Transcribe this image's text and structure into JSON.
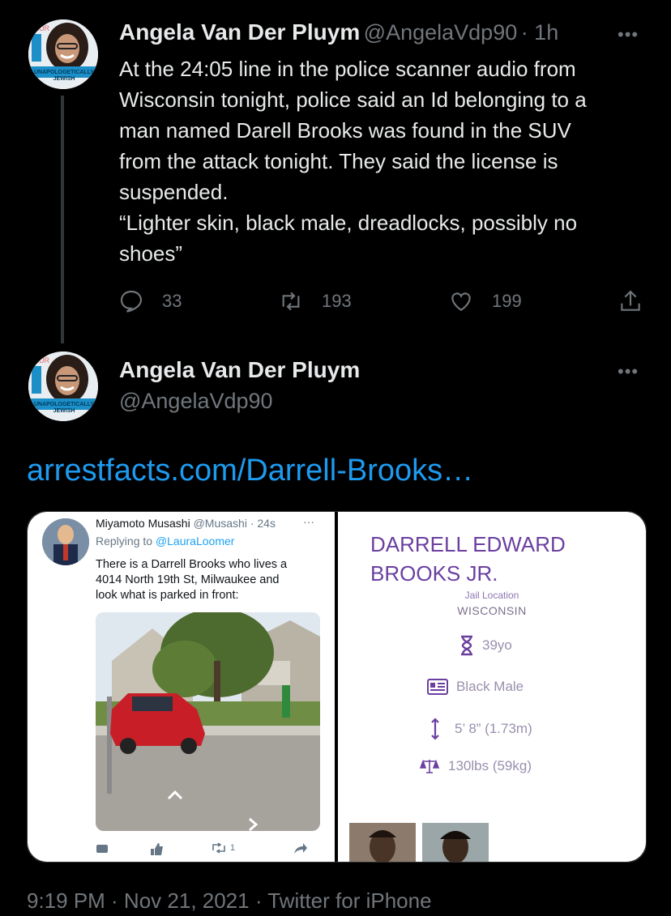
{
  "tweet1": {
    "name": "Angela Van Der Pluym",
    "handle": "@AngelaVdp90",
    "time": "· 1h",
    "text": "At the 24:05 line in the police scanner audio from\nWisconsin tonight, police said an Id belonging to a\nman named Darell Brooks was found in the SUV\nfrom the attack tonight. They said the license is\nsuspended.\n“Lighter skin, black male, dreadlocks, possibly no\nshoes”",
    "replies": "33",
    "retweets": "193",
    "likes": "199",
    "more": "•••"
  },
  "avatar": {
    "top_text": "LAUR",
    "banner_text": "UNAPOLOGETICALLY",
    "banner_sub": "JEWISH"
  },
  "tweet2": {
    "name": "Angela Van Der Pluym",
    "handle": "@AngelaVdp90",
    "more": "•••",
    "link": "arrestfacts.com/Darrell-Brooks…"
  },
  "embedded": {
    "name": "Miyamoto Musashi",
    "handle": "@Musashi",
    "time": "· 24s",
    "more": "···",
    "replying_prefix": "Replying to ",
    "replying_to": "@LauraLoomer",
    "text": "There is a Darrell Brooks who lives a\n4014 North 19th St, Milwaukee and\nlook what is parked in front:",
    "retweet_count": "1"
  },
  "arrest": {
    "name_line1": "DARRELL EDWARD",
    "name_line2": "BROOKS JR.",
    "jail_label": "Jail Location",
    "jail_value": "WISCONSIN",
    "age": "39yo",
    "race_sex": "Black Male",
    "height": "5’ 8” (1.73m)",
    "weight": "130lbs (59kg)"
  },
  "footer": {
    "timestamp": "9:19 PM · Nov 21, 2021 · Twitter for iPhone"
  },
  "colors": {
    "background": "#000000",
    "link": "#1d9bf0",
    "muted": "#71767b",
    "purple": "#6b3fa0",
    "mini_link": "#1da1f2"
  }
}
